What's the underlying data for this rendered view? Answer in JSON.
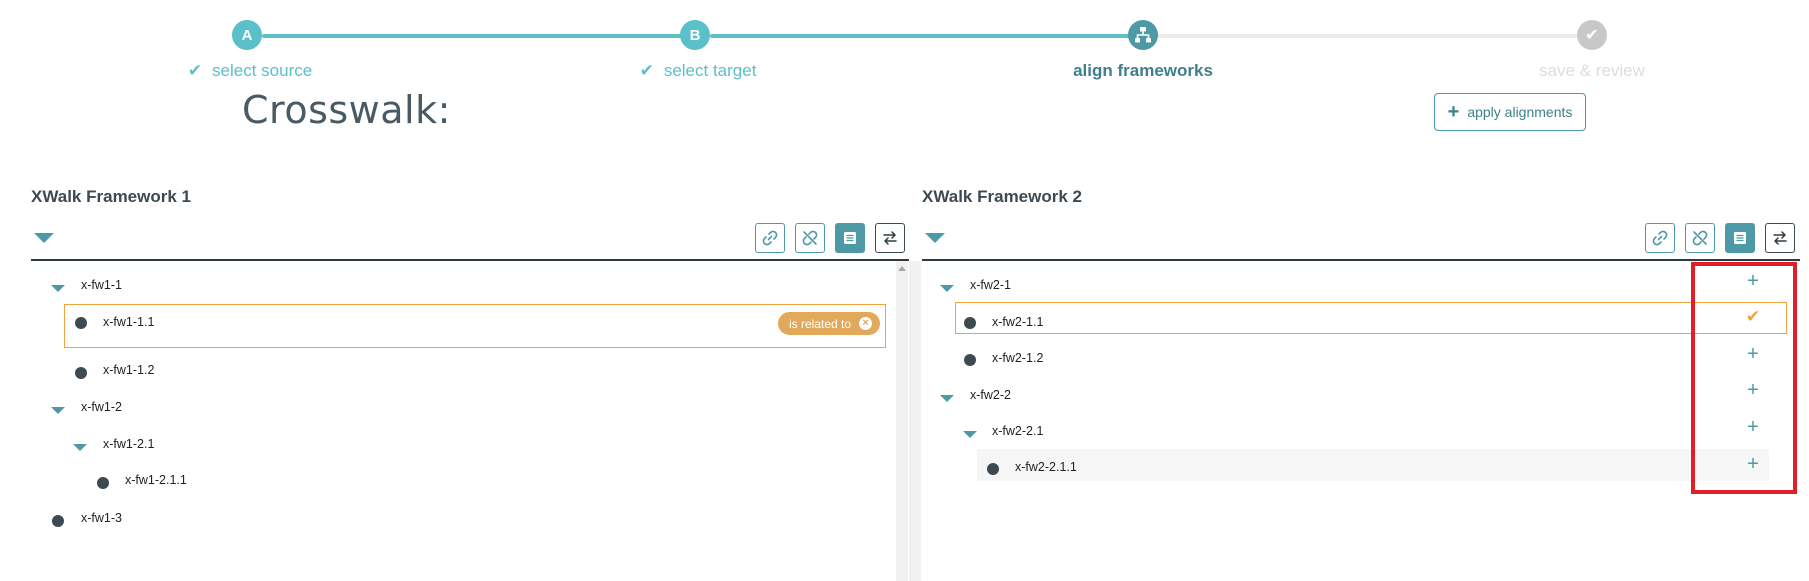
{
  "stepper": {
    "steps": [
      {
        "badge": "A",
        "label": "select source",
        "state": "done"
      },
      {
        "badge": "B",
        "label": "select target",
        "state": "done"
      },
      {
        "badge": "",
        "label": "align frameworks",
        "state": "active",
        "icon": "hierarchy-icon"
      },
      {
        "badge": "",
        "label": "save & review",
        "state": "todo",
        "icon": "check-icon"
      }
    ],
    "check_glyph": "✔"
  },
  "page": {
    "title": "Crosswalk:",
    "apply_button": {
      "label": "apply alignments",
      "icon": "+"
    }
  },
  "left_panel": {
    "title": "XWalk Framework 1",
    "toolbar": [
      "link-icon",
      "unlink-icon",
      "list-icon",
      "swap-icon"
    ],
    "nodes": [
      {
        "text": "x-fw1-1",
        "type": "branch"
      },
      {
        "text": "x-fw1-1.1",
        "type": "leaf",
        "selected": true
      },
      {
        "text": "x-fw1-1.2",
        "type": "leaf"
      },
      {
        "text": "x-fw1-2",
        "type": "branch"
      },
      {
        "text": "x-fw1-2.1",
        "type": "branch"
      },
      {
        "text": "x-fw1-2.1.1",
        "type": "leaf"
      },
      {
        "text": "x-fw1-3",
        "type": "leaf"
      }
    ],
    "relation_badge": {
      "label": "is related to",
      "close": "×"
    }
  },
  "right_panel": {
    "title": "XWalk Framework 2",
    "toolbar": [
      "link-icon",
      "unlink-icon",
      "list-icon",
      "swap-icon"
    ],
    "nodes": [
      {
        "text": "x-fw2-1",
        "type": "branch",
        "action": "+"
      },
      {
        "text": "x-fw2-1.1",
        "type": "leaf",
        "selected": true,
        "action": "✔"
      },
      {
        "text": "x-fw2-1.2",
        "type": "leaf",
        "action": "+"
      },
      {
        "text": "x-fw2-2",
        "type": "branch",
        "action": "+"
      },
      {
        "text": "x-fw2-2.1",
        "type": "branch",
        "action": "+"
      },
      {
        "text": "x-fw2-2.1.1",
        "type": "leaf",
        "action": "+"
      }
    ]
  },
  "colors": {
    "accent": "#4d9aa6",
    "step_done": "#5bc0c9",
    "selection": "#f0a23c",
    "highlight": "#e02027"
  }
}
